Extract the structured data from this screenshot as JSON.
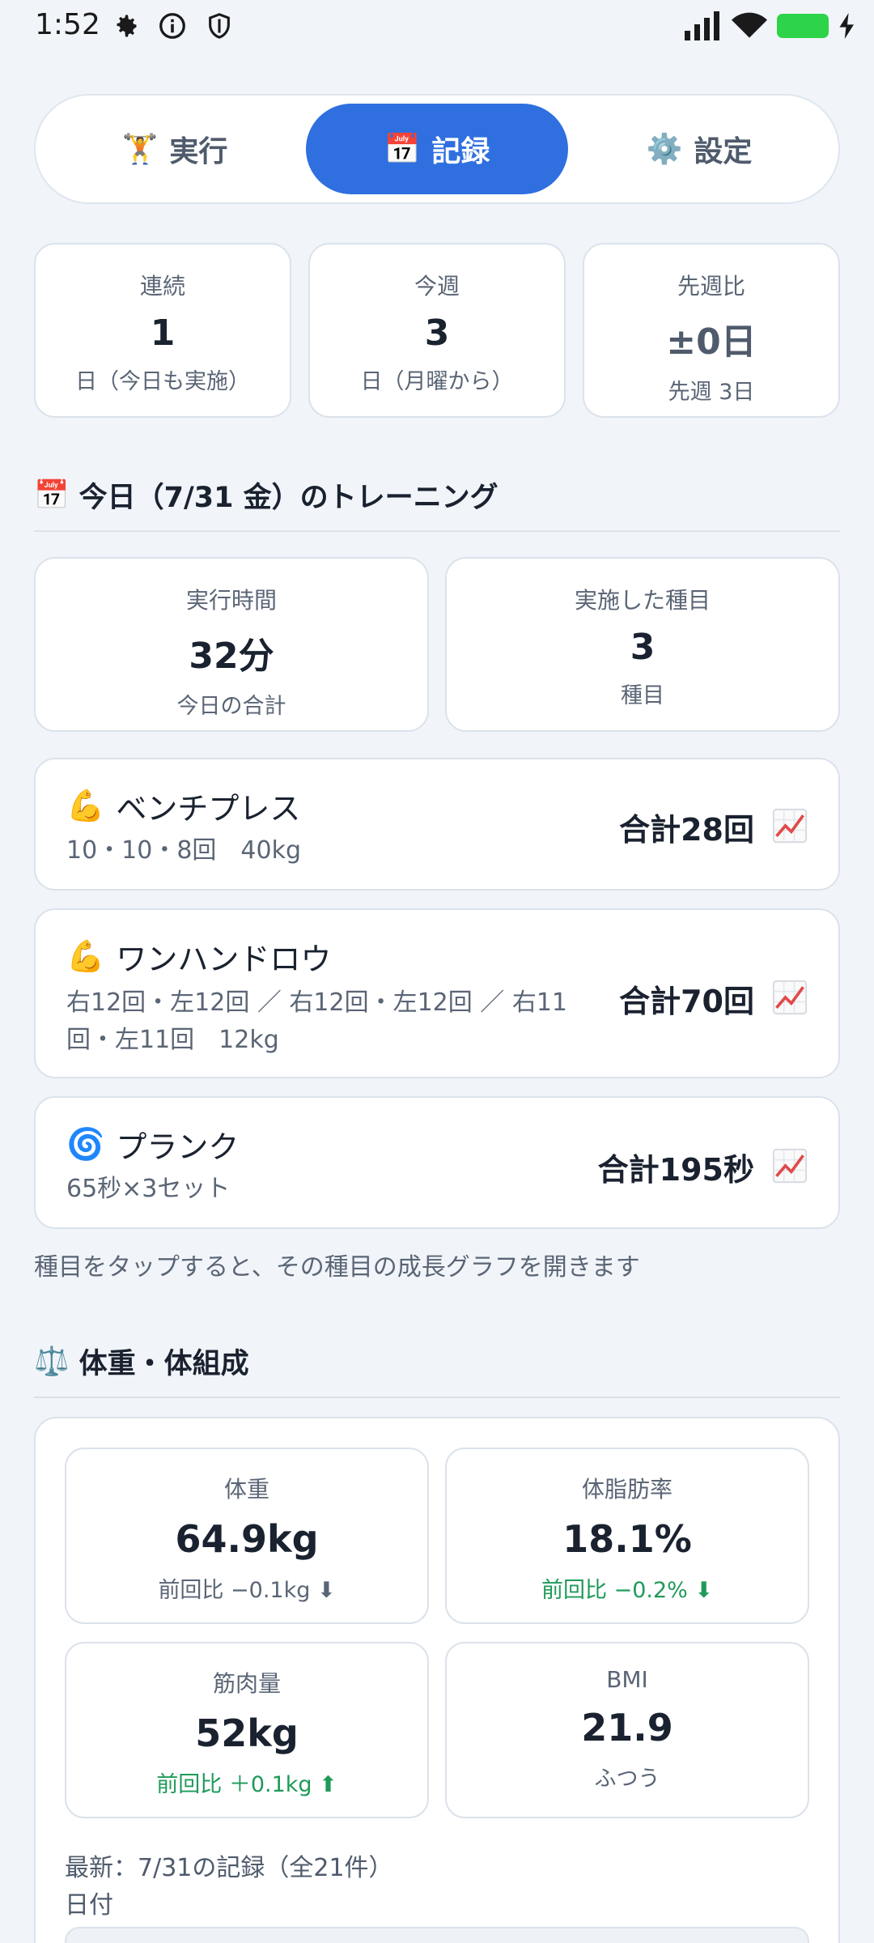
{
  "status": {
    "time": "1:52",
    "icons": [
      "gear-icon",
      "info-icon",
      "shield-icon",
      "signal-icon",
      "wifi-icon",
      "battery-icon"
    ]
  },
  "tabs": [
    {
      "emoji": "🏋",
      "label": "実行"
    },
    {
      "emoji": "📅",
      "label": "記録"
    },
    {
      "emoji": "⚙️",
      "label": "設定"
    }
  ],
  "streak": [
    {
      "label": "連続",
      "value": "1",
      "sub": "日（今日も実施）"
    },
    {
      "label": "今週",
      "value": "3",
      "sub": "日（月曜から）"
    },
    {
      "label": "先週比",
      "value": "±0日",
      "sub": "先週 3日"
    }
  ],
  "today": {
    "emoji": "📅",
    "title": "今日（7/31 金）のトレーニング",
    "summary": [
      {
        "label": "実行時間",
        "value": "32分",
        "sub": "今日の合計"
      },
      {
        "label": "実施した種目",
        "value": "3",
        "sub": "種目"
      }
    ],
    "exercises": [
      {
        "emoji": "💪",
        "name": "ベンチプレス",
        "detail": "10・10・8回　40kg",
        "total": "合計28回"
      },
      {
        "emoji": "💪",
        "name": "ワンハンドロウ",
        "detail": "右12回・左12回 ／ 右12回・左12回 ／ 右11\n回・左11回　12kg",
        "total": "合計70回"
      },
      {
        "emoji": "🌀",
        "name": "プランク",
        "detail": "65秒×3セット",
        "total": "合計195秒"
      }
    ],
    "hint": "種目をタップすると、その種目の成長グラフを開きます"
  },
  "body": {
    "emoji": "⚖️",
    "title": "体重・体組成",
    "cards": [
      {
        "label": "体重",
        "value": "64.9kg",
        "sub": "前回比 −0.1kg ⬇"
      },
      {
        "label": "体脂肪率",
        "value": "18.1%",
        "sub": "前回比 −0.2% ⬇"
      },
      {
        "label": "筋肉量",
        "value": "52kg",
        "sub": "前回比 ＋0.1kg ⬆"
      },
      {
        "label": "BMI",
        "value": "21.9",
        "sub": "ふつう"
      }
    ],
    "latest": "最新：7/31の記録（全21件）",
    "date_label": "日付"
  },
  "colors": {
    "accent": "#2f6fe0",
    "positive": "#1f9a5a",
    "background": "#f1f5fa"
  }
}
